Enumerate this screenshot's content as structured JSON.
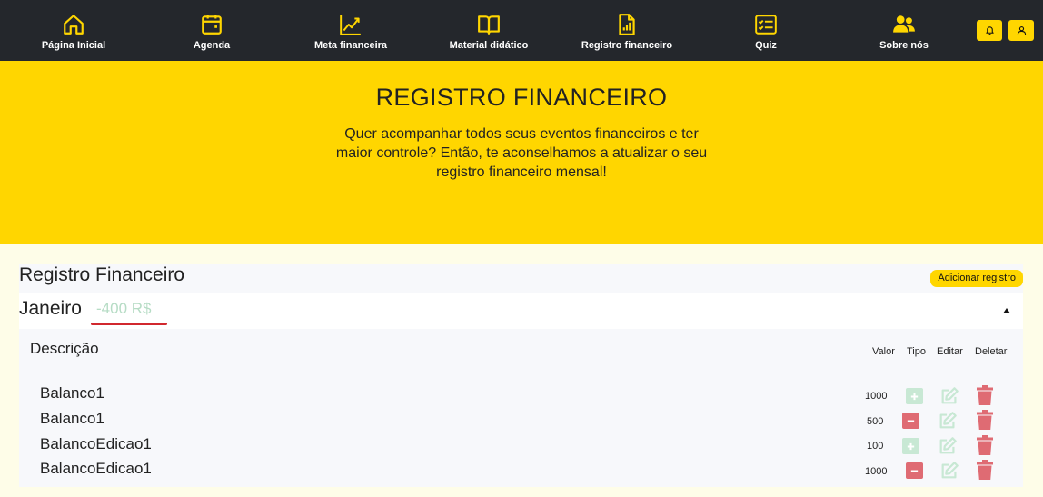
{
  "nav": {
    "items": [
      {
        "label": "Página Inicial",
        "icon": "home-icon"
      },
      {
        "label": "Agenda",
        "icon": "calendar-icon"
      },
      {
        "label": "Meta financeira",
        "icon": "trend-chart-icon"
      },
      {
        "label": "Material didático",
        "icon": "book-icon"
      },
      {
        "label": "Registro financeiro",
        "icon": "report-chart-icon"
      },
      {
        "label": "Quiz",
        "icon": "checklist-icon"
      },
      {
        "label": "Sobre nós",
        "icon": "people-icon"
      }
    ],
    "notifications_icon": "bell-icon",
    "profile_icon": "user-icon"
  },
  "hero": {
    "title": "REGISTRO FINANCEIRO",
    "text": "Quer acompanhar todos seus eventos financeiros e ter maior controle? Então, te aconselhamos a atualizar o seu registro financeiro mensal!"
  },
  "registro": {
    "title": "Registro Financeiro",
    "add_button": "Adicionar registro",
    "month": {
      "name": "Janeiro",
      "total": "-400 R$"
    },
    "columns": {
      "descricao": "Descrição",
      "valor": "Valor",
      "tipo": "Tipo",
      "editar": "Editar",
      "deletar": "Deletar"
    },
    "rows": [
      {
        "descricao": "Balanco1",
        "valor": "1000",
        "tipo": "entrada"
      },
      {
        "descricao": "Balanco1",
        "valor": "500",
        "tipo": "saida"
      },
      {
        "descricao": "BalancoEdicao1",
        "valor": "100",
        "tipo": "entrada"
      },
      {
        "descricao": "BalancoEdicao1",
        "valor": "1000",
        "tipo": "saida"
      }
    ]
  },
  "colors": {
    "nav_bg": "#24272c",
    "accent_yellow": "#ffd600",
    "positive_green": "#c8e8d4",
    "negative_red": "#df6b73",
    "underline_red": "#d1282e"
  }
}
